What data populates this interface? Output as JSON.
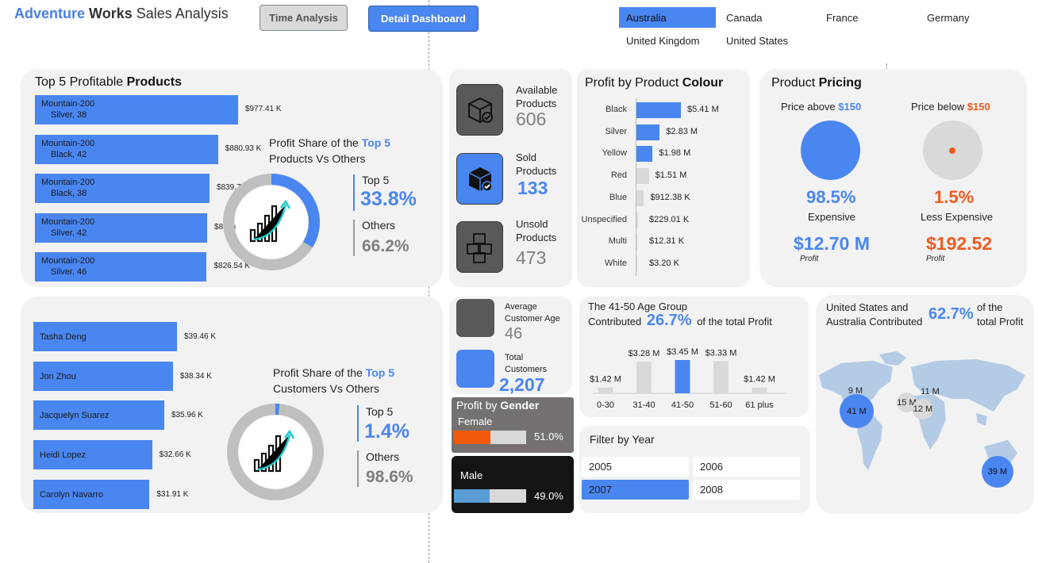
{
  "header": {
    "brand_part1": "Adventure",
    "brand_part2": "Works",
    "brand_part3": "Sales Analysis",
    "tab_time": "Time Analysis",
    "tab_detail": "Detail Dashboard"
  },
  "countries": [
    "Australia",
    "Canada",
    "France",
    "Germany",
    "United Kingdom",
    "United States"
  ],
  "selected_country": "Australia",
  "top_products": {
    "title_plain": "Top 5 Profitable ",
    "title_bold": "Products",
    "items": [
      {
        "line1": "Mountain-200",
        "line2": "Silver, 38",
        "value": "$977.41 K",
        "amount": 977.41
      },
      {
        "line1": "Mountain-200",
        "line2": "Black, 42",
        "value": "$880.93 K",
        "amount": 880.93
      },
      {
        "line1": "Mountain-200",
        "line2": "Black, 38",
        "value": "$839.77 K",
        "amount": 839.77
      },
      {
        "line1": "Mountain-200",
        "line2": "Silver, 42",
        "value": "$828.61 K",
        "amount": 828.61
      },
      {
        "line1": "Mountain-200",
        "line2": "Silver, 46",
        "value": "$826.54 K",
        "amount": 826.54
      }
    ],
    "share_line1_a": "Profit Share of the ",
    "share_line1_b": "Top 5",
    "share_line2": "Products Vs Others",
    "top_label": "Top 5",
    "top_value": "33.8%",
    "top_fraction": 0.338,
    "others_label": "Others",
    "others_value": "66.2%"
  },
  "inventory": {
    "available_label_1": "Available",
    "available_label_2": "Products",
    "available_value": "606",
    "sold_label_1": "Sold",
    "sold_label_2": "Products",
    "sold_value": "133",
    "unsold_label_1": "Unsold",
    "unsold_label_2": "Products",
    "unsold_value": "473"
  },
  "colour": {
    "title_plain": "Profit by Product ",
    "title_bold": "Colour",
    "rows": [
      {
        "name": "Black",
        "value": "$5.41 M",
        "amount": 5.41
      },
      {
        "name": "Silver",
        "value": "$2.83 M",
        "amount": 2.83
      },
      {
        "name": "Yellow",
        "value": "$1.98 M",
        "amount": 1.98
      },
      {
        "name": "Red",
        "value": "$1.51 M",
        "amount": 1.51
      },
      {
        "name": "Blue",
        "value": "$912.38 K",
        "amount": 0.91238
      },
      {
        "name": "Unspecified",
        "value": "$229.01 K",
        "amount": 0.22901
      },
      {
        "name": "Multi",
        "value": "$12.31 K",
        "amount": 0.01231
      },
      {
        "name": "White",
        "value": "$3.20 K",
        "amount": 0.0032
      }
    ]
  },
  "pricing": {
    "title_plain": "Product ",
    "title_bold": "Pricing",
    "above_label": "Price above ",
    "above_price": "$150",
    "below_label": "Price below ",
    "below_price": "$150",
    "above_pct": "98.5%",
    "above_fraction": 0.985,
    "above_desc": "Expensive",
    "below_pct": "1.5%",
    "below_fraction": 0.015,
    "below_desc": "Less Expensive",
    "above_profit": "$12.70 M",
    "below_profit": "$192.52",
    "profit_caption": "Profit"
  },
  "top_customers": {
    "items": [
      {
        "name": "Tasha Deng",
        "value": "$39.46 K",
        "amount": 39.46
      },
      {
        "name": "Jon Zhou",
        "value": "$38.34 K",
        "amount": 38.34
      },
      {
        "name": "Jacquelyn Suarez",
        "value": "$35.96 K",
        "amount": 35.96
      },
      {
        "name": "Heidi Lopez",
        "value": "$32.66 K",
        "amount": 32.66
      },
      {
        "name": "Carolyn Navarro",
        "value": "$31.91 K",
        "amount": 31.91
      }
    ],
    "share_line1_a": "Profit Share of the ",
    "share_line1_b": "Top 5",
    "share_line2": "Customers Vs Others",
    "top_label": "Top 5",
    "top_value": "1.4%",
    "top_fraction": 0.014,
    "others_label": "Others",
    "others_value": "98.6%"
  },
  "customers": {
    "avg_age_label_1": "Average",
    "avg_age_label_2": "Customer Age",
    "avg_age_value": "46",
    "total_label_1": "Total",
    "total_label_2": "Customers",
    "total_value": "2,207"
  },
  "gender": {
    "title_plain": "Profit by ",
    "title_bold": "Gender",
    "female_label": "Female",
    "female_value": "51.0%",
    "female_fraction": 0.51,
    "male_label": "Male",
    "male_value": "49.0%",
    "male_fraction": 0.49,
    "female_color": "#f15a0a",
    "male_color": "#5b9bd5"
  },
  "age": {
    "line1": "The 41-50 Age Group",
    "line2_a": "Contributed",
    "line2_pct": "26.7%",
    "line2_b": "of the total Profit",
    "chart_data": {
      "type": "bar",
      "categories": [
        "0-30",
        "31-40",
        "41-50",
        "51-60",
        "61 plus"
      ],
      "values": [
        1.42,
        3.28,
        3.45,
        3.33,
        1.42
      ],
      "labels": [
        "$1.42 M",
        "$3.28 M",
        "$3.45 M",
        "$3.33 M",
        "$1.42 M"
      ],
      "highlight_index": 2,
      "highlight_color": "#4a86f0",
      "base_color": "#d9d9d9"
    }
  },
  "year_filter": {
    "title": "Filter by Year",
    "years": [
      "2005",
      "2006",
      "2007",
      "2008"
    ],
    "selected": "2007"
  },
  "geo": {
    "line1": "United States and",
    "line2": "Australia Contributed",
    "pct": "62.7%",
    "tail1": "of the",
    "tail2": "total Profit",
    "bubbles": [
      {
        "label": "9 M"
      },
      {
        "label": "41 M"
      },
      {
        "label": "15 M"
      },
      {
        "label": "11 M"
      },
      {
        "label": "12 M"
      },
      {
        "label": "39 M"
      }
    ]
  },
  "colors": {
    "accent": "#4a86f0",
    "orange": "#f15a22",
    "card": "#f2f2f2"
  }
}
